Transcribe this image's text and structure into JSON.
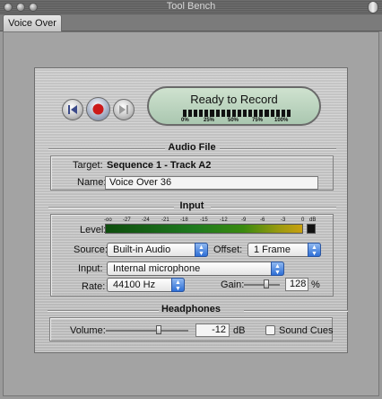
{
  "window": {
    "title": "Tool Bench"
  },
  "tabs": [
    {
      "label": "Voice Over"
    }
  ],
  "transport": {
    "status_text": "Ready to Record",
    "meter_labels": [
      "0%",
      "25%",
      "50%",
      "75%",
      "100%"
    ]
  },
  "audio_file": {
    "section_title": "Audio File",
    "target_label": "Target:",
    "target_value": "Sequence 1 - Track A2",
    "name_label": "Name:",
    "name_value": "Voice Over 36"
  },
  "input": {
    "section_title": "Input",
    "level_label": "Level:",
    "level_ticks": [
      "-oo",
      "-27",
      "-24",
      "-21",
      "-18",
      "-15",
      "-12",
      "-9",
      "-6",
      "-3",
      "0",
      "dB"
    ],
    "source_label": "Source:",
    "source_value": "Built-in Audio",
    "offset_label": "Offset:",
    "offset_value": "1 Frame",
    "input_label": "Input:",
    "input_value": "Internal microphone",
    "rate_label": "Rate:",
    "rate_value": "44100 Hz",
    "gain_label": "Gain:",
    "gain_value": "128",
    "gain_unit": "%"
  },
  "headphones": {
    "section_title": "Headphones",
    "volume_label": "Volume:",
    "volume_value": "-12",
    "volume_unit": "dB",
    "sound_cues_label": "Sound Cues",
    "sound_cues_checked": false
  }
}
